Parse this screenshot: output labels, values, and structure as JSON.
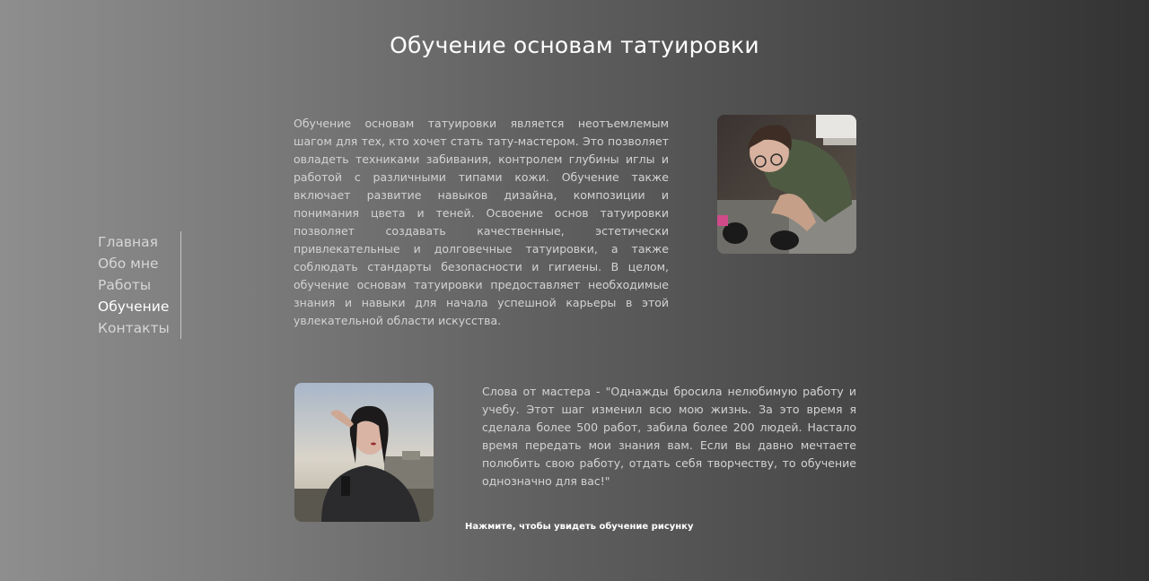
{
  "page": {
    "title": "Обучение основам татуировки"
  },
  "nav": {
    "items": [
      {
        "label": "Главная",
        "active": false
      },
      {
        "label": "Обо мне",
        "active": false
      },
      {
        "label": "Работы",
        "active": false
      },
      {
        "label": "Обучение",
        "active": true
      },
      {
        "label": "Контакты",
        "active": false
      }
    ]
  },
  "content": {
    "intro_text": "Обучение основам татуировки является неотъемлемым шагом для тех, кто хочет стать тату-мастером. Это позволяет овладеть техниками забивания, контролем глубины иглы и работой с различными типами кожи. Обучение также включает развитие навыков дизайна, композиции и понимания цвета и теней. Освоение основ татуировки позволяет создавать качественные, эстетически привлекательные и долговечные татуировки, а также соблюдать стандарты безопасности и гигиены. В целом, обучение основам татуировки предоставляет необходимые знания и навыки для начала успешной карьеры в этой увлекательной области искусства.",
    "quote_text": "Слова от мастера - \"Однажды бросила нелюбимую работу и учебу. Этот шаг изменил всю мою жизнь. За это время я сделала более 500 работ, забила более 200 людей. Настало время передать мои знания вам. Если вы давно мечтаете полюбить свою работу, отдать себя творчеству, то обучение однозначно для вас!\"",
    "cta_label": "Нажмите, чтобы увидеть обучение рисунку"
  }
}
